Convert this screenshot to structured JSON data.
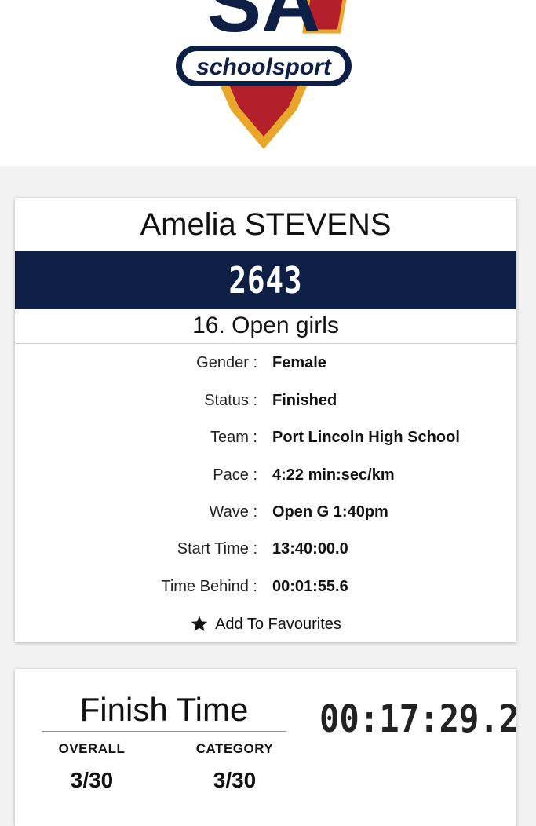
{
  "brand": {
    "logo_text": "SA",
    "logo_banner": "schoolsport",
    "colors": {
      "navy": "#0e1f45",
      "red": "#b3202c",
      "gold": "#e8a62a"
    }
  },
  "athlete": {
    "name": "Amelia STEVENS",
    "bib": "2643",
    "category": "16. Open girls"
  },
  "details": [
    {
      "label": "Gender :",
      "value": "Female"
    },
    {
      "label": "Status :",
      "value": "Finished"
    },
    {
      "label": "Team :",
      "value": "Port Lincoln High School"
    },
    {
      "label": "Pace :",
      "value": "4:22 min:sec/km"
    },
    {
      "label": "Wave :",
      "value": "Open G 1:40pm"
    },
    {
      "label": "Start Time :",
      "value": "13:40:00.0"
    },
    {
      "label": "Time Behind :",
      "value": "00:01:55.6"
    }
  ],
  "favourites": {
    "label": "Add To Favourites",
    "icon": "star-icon"
  },
  "result": {
    "finish_label": "Finish Time",
    "finish_time": "00:17:29.2",
    "overall": {
      "label": "OVERALL",
      "value": "3/30"
    },
    "category": {
      "label": "CATEGORY",
      "value": "3/30"
    }
  }
}
